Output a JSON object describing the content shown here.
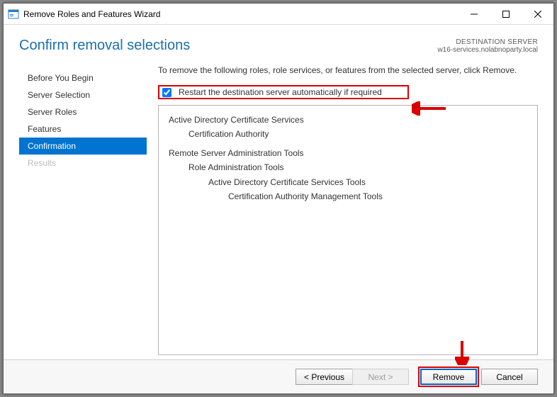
{
  "window": {
    "title": "Remove Roles and Features Wizard"
  },
  "header": {
    "heading": "Confirm removal selections",
    "destination_label": "DESTINATION SERVER",
    "destination_value": "w16-services.nolabnoparty.local"
  },
  "sidebar": {
    "items": [
      {
        "label": "Before You Begin",
        "state": "normal"
      },
      {
        "label": "Server Selection",
        "state": "normal"
      },
      {
        "label": "Server Roles",
        "state": "normal"
      },
      {
        "label": "Features",
        "state": "normal"
      },
      {
        "label": "Confirmation",
        "state": "selected"
      },
      {
        "label": "Results",
        "state": "disabled"
      }
    ]
  },
  "content": {
    "instruction": "To remove the following roles, role services, or features from the selected server, click Remove.",
    "restart_checkbox_label": "Restart the destination server automatically if required",
    "restart_checked": true,
    "removal_tree": [
      {
        "text": "Active Directory Certificate Services",
        "level": 0
      },
      {
        "text": "Certification Authority",
        "level": 1
      },
      {
        "text": "Remote Server Administration Tools",
        "level": 0,
        "gap": true
      },
      {
        "text": "Role Administration Tools",
        "level": 1
      },
      {
        "text": "Active Directory Certificate Services Tools",
        "level": 2
      },
      {
        "text": "Certification Authority Management Tools",
        "level": 3
      }
    ]
  },
  "footer": {
    "previous": "< Previous",
    "next": "Next >",
    "remove": "Remove",
    "cancel": "Cancel"
  }
}
